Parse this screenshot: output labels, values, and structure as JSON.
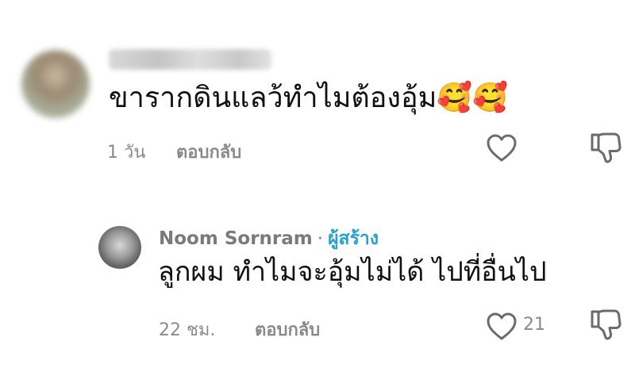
{
  "comments": [
    {
      "body": "ขารากดินแลว้ทำไมต้องอุ้ม",
      "emoji": "🥰🥰",
      "time": "1 วัน",
      "reply_label": "ตอบกลับ",
      "like_icon": "heart-outline-icon",
      "dislike_icon": "thumbs-down-icon"
    },
    {
      "author": "Noom Sornram",
      "separator": "·",
      "badge": "ผู้สร้าง",
      "body": "ลูกผม ทำไมจะอุ้มไม่ได้ ไปที่อื่นไป",
      "time": "22 ชม.",
      "reply_label": "ตอบกลับ",
      "likes": "21",
      "like_icon": "heart-outline-icon",
      "dislike_icon": "thumbs-down-icon"
    }
  ],
  "colors": {
    "meta_text": "#8a8a8a",
    "creator_badge": "#2b9fd0",
    "icon_stroke": "#6b6b6b"
  }
}
